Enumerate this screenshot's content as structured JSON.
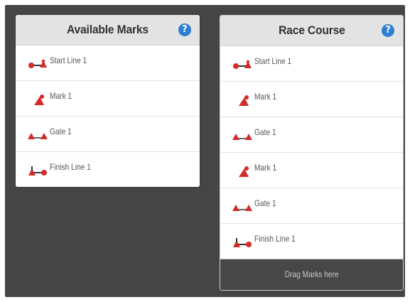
{
  "available_panel": {
    "title": "Available Marks",
    "help_glyph": "?",
    "items": [
      {
        "label": "Start Line 1",
        "icon": "start-line-icon"
      },
      {
        "label": "Mark 1",
        "icon": "mark-icon"
      },
      {
        "label": "Gate 1",
        "icon": "gate-icon"
      },
      {
        "label": "Finish Line 1",
        "icon": "finish-line-icon"
      }
    ]
  },
  "course_panel": {
    "title": "Race Course",
    "help_glyph": "?",
    "items": [
      {
        "label": "Start Line 1",
        "icon": "start-line-icon"
      },
      {
        "label": "Mark 1",
        "icon": "mark-icon"
      },
      {
        "label": "Gate 1",
        "icon": "gate-icon"
      },
      {
        "label": "Mark 1",
        "icon": "mark-icon"
      },
      {
        "label": "Gate 1",
        "icon": "gate-icon"
      },
      {
        "label": "Finish Line 1",
        "icon": "finish-line-icon"
      }
    ],
    "drop_hint": "Drag Marks here"
  },
  "colors": {
    "mark_red": "#d42a2a",
    "help_blue": "#2f7fd0",
    "frame_bg": "#454545"
  }
}
